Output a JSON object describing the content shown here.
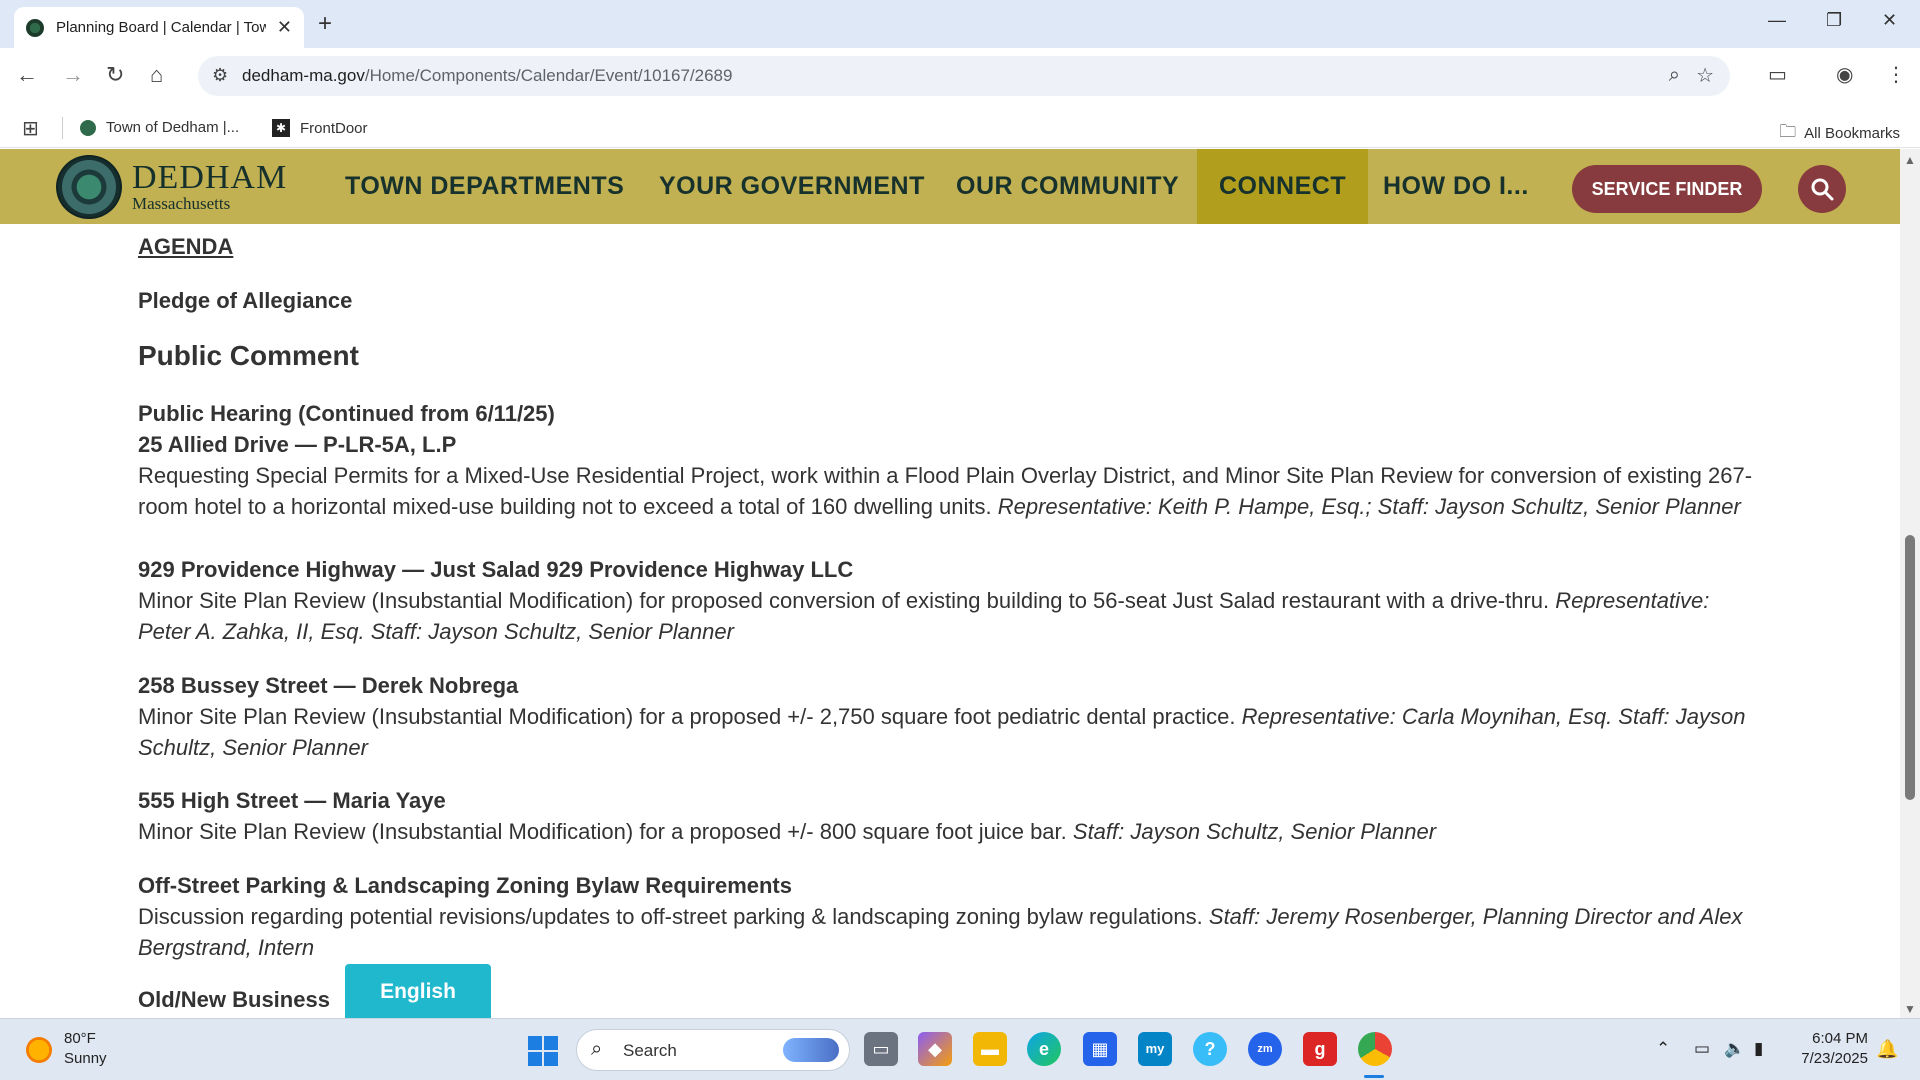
{
  "browser": {
    "tab_title": "Planning Board | Calendar | Town of Dedham",
    "url_host": "dedham-ma.gov",
    "url_path": "/Home/Components/Calendar/Event/10167/2689",
    "bookmarks": [
      "Town of Dedham |...",
      "FrontDoor"
    ],
    "all_bookmarks": "All Bookmarks"
  },
  "site": {
    "logo_title": "DEDHAM",
    "logo_subtitle": "Massachusetts",
    "nav": [
      "TOWN DEPARTMENTS",
      "YOUR GOVERNMENT",
      "OUR COMMUNITY",
      "CONNECT",
      "HOW DO I..."
    ],
    "active_nav": "CONNECT",
    "service_finder": "SERVICE FINDER",
    "accent": "#c2b152",
    "active_color": "#b19e1d",
    "button_color": "#873b3e"
  },
  "content": {
    "agenda": "AGENDA ",
    "pledge": "Pledge of Allegiance",
    "public_comment": "Public Comment",
    "items": [
      {
        "heading": "Public Hearing (Continued from 6/11/25)",
        "heading2": "25 Allied Drive — P-LR-5A, L.P",
        "text": "Requesting Special Permits for a Mixed-Use Residential Project, work within a Flood Plain Overlay District, and Minor Site Plan Review for conversion of existing 267-room hotel to a horizontal mixed-use building not to exceed a total of 160 dwelling units. ",
        "italic": "Representative: Keith P. Hampe, Esq.; Staff: Jayson Schultz, Senior Planner"
      },
      {
        "heading": "929 Providence Highway — Just Salad 929 Providence Highway LLC",
        "text": "Minor Site Plan Review (Insubstantial Modification) for proposed conversion of existing building to 56-seat Just Salad restaurant with a drive-thru. ",
        "italic": "Representative: Peter A. Zahka, II, Esq. Staff: Jayson Schultz, Senior Planner"
      },
      {
        "heading": "258 Bussey Street — Derek Nobrega",
        "text": "Minor Site Plan Review (Insubstantial Modification) for a proposed +/- 2,750 square foot pediatric dental practice. ",
        "italic": "Representative: Carla Moynihan, Esq. Staff: Jayson Schultz, Senior Planner"
      },
      {
        "heading": "555 High Street — Maria Yaye",
        "text": "Minor Site Plan Review (Insubstantial Modification) for a proposed +/- 800 square foot juice bar.  ",
        "italic": "Staff: Jayson Schultz, Senior Planner"
      },
      {
        "heading": "Off-Street Parking & Landscaping Zoning Bylaw Requirements",
        "text": "Discussion regarding potential revisions/updates to off-street parking & landscaping zoning bylaw regulations. ",
        "italic": "Staff: Jeremy Rosenberger, Planning Director and Alex Bergstrand, Intern"
      }
    ],
    "old_new_business": "Old/New Business",
    "english_button": "English"
  },
  "taskbar": {
    "temperature": "80°F",
    "condition": "Sunny",
    "search_placeholder": "Search",
    "time": "6:04 PM",
    "date": "7/23/2025"
  }
}
